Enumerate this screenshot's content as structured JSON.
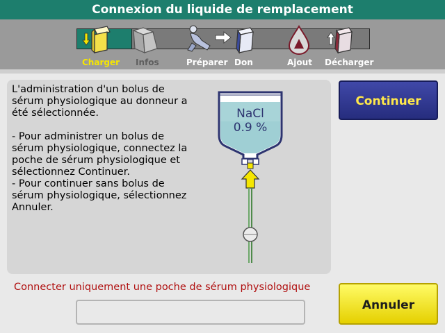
{
  "window": {
    "title": "Connexion du liquide de remplacement"
  },
  "steps": [
    {
      "label": "Charger",
      "icon": "load-icon",
      "state": "active"
    },
    {
      "label": "Infos",
      "icon": "folder-icon",
      "state": "disabled"
    },
    {
      "label": "Préparer",
      "icon": "donor-icon",
      "state": "pending"
    },
    {
      "label": "Don",
      "icon": "collection-icon",
      "state": "pending"
    },
    {
      "label": "Ajout",
      "icon": "additive-flask-icon",
      "state": "pending"
    },
    {
      "label": "Décharger",
      "icon": "unload-icon",
      "state": "pending"
    }
  ],
  "instructions": {
    "intro": "L'administration d'un bolus de sérum physiologique au donneur a été sélectionnée.",
    "option1": "- Pour administrer un bolus de sérum physiologique, connectez la poche de sérum physiologique et sélectionnez Continuer.",
    "option2": "- Pour continuer sans bolus de sérum physiologique, sélectionnez Annuler."
  },
  "bag": {
    "line1": "NaCl",
    "line2": "0.9 %"
  },
  "buttons": {
    "continue": "Continuer",
    "cancel": "Annuler"
  },
  "warning": "Connecter uniquement une poche de sérum physiologique",
  "colors": {
    "header": "#1d7e6d",
    "active_step": "#f5e600",
    "continue_bg": "#2e3590",
    "cancel_bg": "#f0e020",
    "warning": "#b01010"
  }
}
